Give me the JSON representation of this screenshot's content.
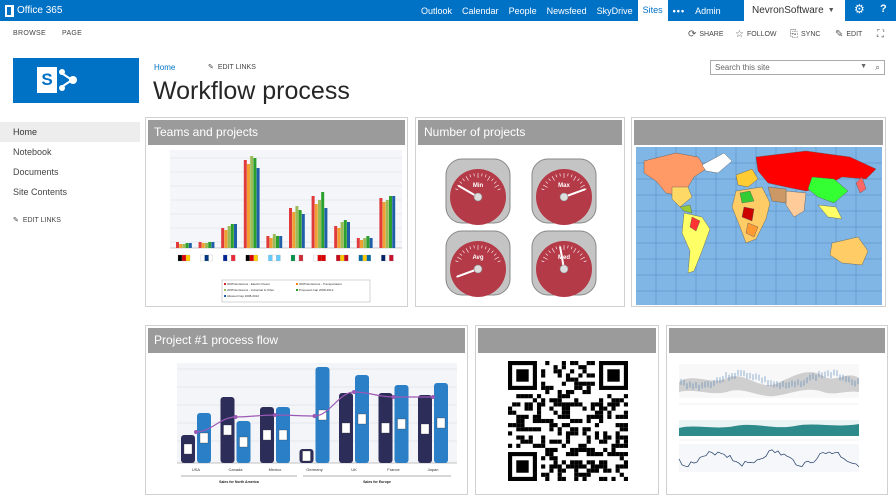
{
  "suite": {
    "brand": "Office 365",
    "nav": [
      "Outlook",
      "Calendar",
      "People",
      "Newsfeed",
      "SkyDrive",
      "Sites",
      "•••",
      "Admin"
    ],
    "active_nav": "Sites",
    "user": "NevronSoftware"
  },
  "ribbon": {
    "tabs": [
      "BROWSE",
      "PAGE"
    ],
    "actions": [
      {
        "label": "SHARE",
        "icon": "share-icon"
      },
      {
        "label": "FOLLOW",
        "icon": "star-icon"
      },
      {
        "label": "SYNC",
        "icon": "sync-icon"
      },
      {
        "label": "EDIT",
        "icon": "pencil-icon"
      }
    ]
  },
  "breadcrumb": {
    "home": "Home",
    "edit_links": "EDIT LINKS"
  },
  "page_title": "Workflow process",
  "search": {
    "placeholder": "Search this site"
  },
  "leftnav": {
    "items": [
      "Home",
      "Notebook",
      "Documents",
      "Site Contents"
    ],
    "edit_links": "EDIT LINKS"
  },
  "webparts": {
    "teams": {
      "title": "Teams and projects"
    },
    "number": {
      "title": "Number of projects"
    },
    "map": {
      "title": ""
    },
    "flow": {
      "title": "Project #1 process flow"
    },
    "qr": {
      "title": ""
    },
    "weather": {
      "title": ""
    }
  },
  "gauges": [
    "Min",
    "Max",
    "Avg",
    "Med"
  ],
  "chart_legend": [
    "2005 Emissions - Electric Power",
    "2005 Emissions - Transportation",
    "2005 Emissions - Industrial & Other",
    "Proposed Cap 2008-2012",
    "Allowed Cap 2008-2012"
  ],
  "flow_groups": [
    "Sales for North America",
    "Sales for Europe"
  ],
  "flow_categories": [
    "USA",
    "Canada",
    "Mexico",
    "Germany",
    "UK",
    "France",
    "Japan"
  ],
  "colors": {
    "suite_bar": "#0072c6",
    "header_gray": "#9b9b9b"
  }
}
